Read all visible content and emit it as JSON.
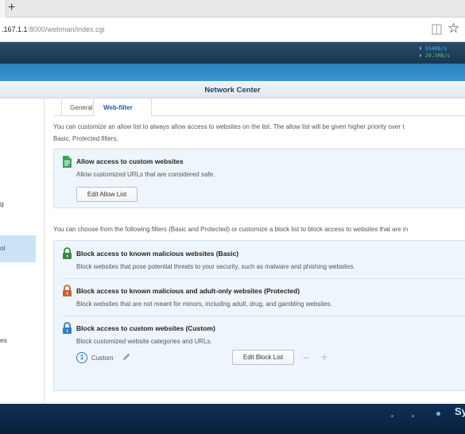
{
  "browser": {
    "new_tab_label": "+",
    "url_host": ".167.1.1",
    "url_rest": ":8000/webman/index.cgi"
  },
  "taskbar": {
    "upload_speed": "914KB/s",
    "download_speed": "29.5MB/s"
  },
  "window": {
    "title": "Network Center"
  },
  "sidebar": {
    "items": [
      {
        "label": "g"
      },
      {
        "label": "ol"
      },
      {
        "label": "es"
      }
    ]
  },
  "tabs": {
    "general": "General",
    "web_filter": "Web-filter"
  },
  "allow": {
    "intro_line1": "You can customize an allow list to always allow access to websites on the list. The allow list will be given higher priority over t",
    "intro_line2": "Basic, Protected filters.",
    "title": "Allow access to custom websites",
    "desc": "Allow customized URLs that are considered safe.",
    "button": "Edit Allow List"
  },
  "block": {
    "intro": "You can choose from the following filters (Basic and Protected) or customize a block list to block access to websites that are in",
    "basic_title": "Block access to known malicious websites (Basic)",
    "basic_desc": "Block websites that pose potential threats to your security, such as malware and phishing websites.",
    "protected_title": "Block access to known malicious and adult-only websites (Protected)",
    "protected_desc": "Block websites that are not meant for minors, including adult, drug, and gambling websites.",
    "custom_title": "Block access to custom websites (Custom)",
    "custom_desc": "Block customized website categories and URLs.",
    "custom_count": "1",
    "custom_label": "Custom",
    "edit_button": "Edit Block List",
    "minus": "−",
    "plus": "+"
  },
  "brand_partial": "Sy",
  "colors": {
    "allow_icon": "#3aa35a",
    "basic_lock": "#3b8a3e",
    "protected_lock": "#c8642e",
    "custom_lock": "#2a7fc8"
  }
}
